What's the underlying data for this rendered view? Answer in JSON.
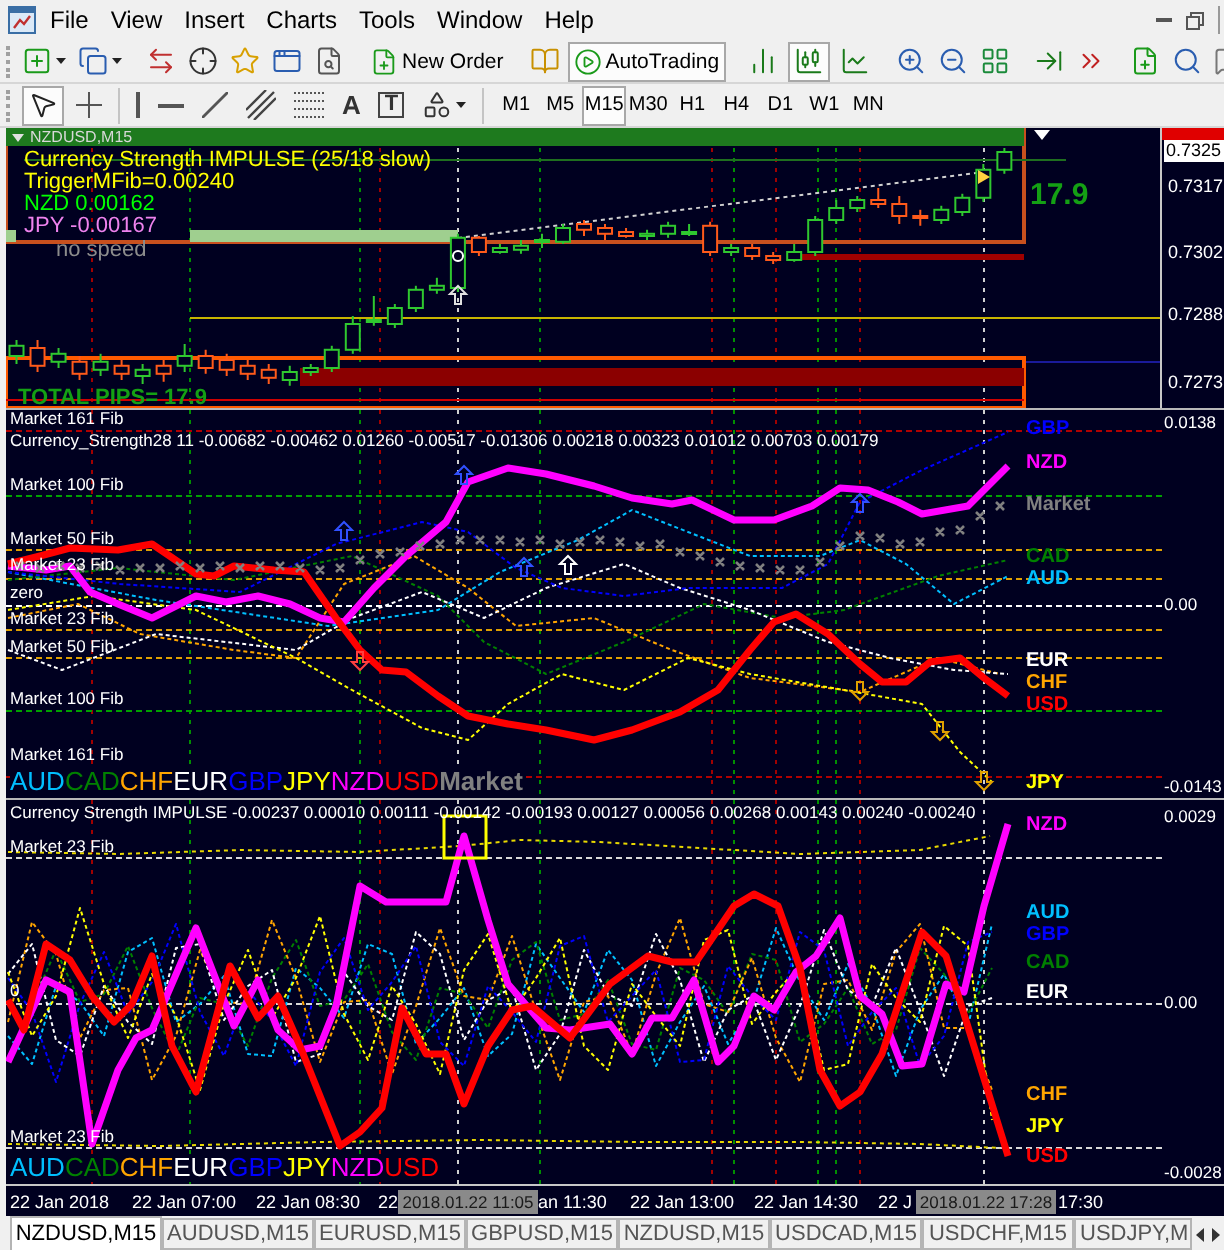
{
  "menu": {
    "items": [
      "File",
      "View",
      "Insert",
      "Charts",
      "Tools",
      "Window",
      "Help"
    ]
  },
  "toolbar": {
    "new_order": "New Order",
    "autotrading": {
      "label": "AutoTrading",
      "on": true
    },
    "chart_types": [
      {
        "kind": "bars",
        "selected": false
      },
      {
        "kind": "candles",
        "selected": true
      },
      {
        "kind": "line",
        "selected": false
      }
    ]
  },
  "drawing_toolbar": {
    "tools": [
      {
        "kind": "cursor",
        "selected": true
      },
      {
        "kind": "crosshair",
        "selected": false
      },
      {
        "kind": "vline",
        "selected": false
      },
      {
        "kind": "hline",
        "selected": false
      },
      {
        "kind": "trendline",
        "selected": false
      },
      {
        "kind": "channel",
        "selected": false
      },
      {
        "kind": "fibo",
        "selected": false
      },
      {
        "kind": "text",
        "label": "A",
        "selected": false
      },
      {
        "kind": "label",
        "label": "T",
        "selected": false
      },
      {
        "kind": "arrows",
        "selected": false
      }
    ],
    "timeframes": [
      {
        "label": "M1",
        "selected": false
      },
      {
        "label": "M5",
        "selected": false
      },
      {
        "label": "M15",
        "selected": true
      },
      {
        "label": "M30",
        "selected": false
      },
      {
        "label": "H1",
        "selected": false
      },
      {
        "label": "H4",
        "selected": false
      },
      {
        "label": "D1",
        "selected": false
      },
      {
        "label": "W1",
        "selected": false
      },
      {
        "label": "MN",
        "selected": false
      }
    ]
  },
  "chart": {
    "title": "NZDUSD,M15",
    "main_panel": {
      "info": [
        {
          "text": "Currency Strength IMPULSE (25/18 slow)",
          "color": "#ffff00"
        },
        {
          "text": "TriggerMFib=0.00240",
          "color": "#ffff00"
        },
        {
          "text": "NZD 0.00162",
          "color": "#00ff00"
        },
        {
          "text": "JPY -0.00167",
          "color": "#ee82ee"
        }
      ],
      "speed_note": "no speed",
      "pips": "17.9",
      "total_pips": "TOTAL PIPS= 17.9",
      "current_price": "0.7325",
      "chart_data": {
        "type": "candlestick",
        "categories": [
          null,
          null,
          null,
          null,
          null,
          null,
          null,
          null,
          null,
          null,
          null,
          null,
          null,
          null,
          null,
          null,
          null,
          null,
          null,
          null,
          null,
          null,
          null,
          null,
          null,
          null,
          null,
          null,
          null,
          null,
          null,
          null,
          null,
          null,
          null,
          null,
          null,
          null,
          null,
          null,
          null,
          null,
          null,
          null,
          null,
          null,
          null,
          null,
          null,
          null,
          null,
          null,
          null,
          null,
          null
        ],
        "ohlc": [
          [
            0.72787,
            0.72823,
            0.72769,
            0.7281
          ],
          [
            0.72805,
            0.72823,
            0.72751,
            0.72765
          ],
          [
            0.72774,
            0.72805,
            0.7276,
            0.72792
          ],
          [
            0.72774,
            0.72787,
            0.72733,
            0.72747
          ],
          [
            0.72756,
            0.72792,
            0.72742,
            0.72774
          ],
          [
            0.72765,
            0.72778,
            0.72733,
            0.72747
          ],
          [
            0.72742,
            0.72769,
            0.72724,
            0.72756
          ],
          [
            0.72765,
            0.72778,
            0.72729,
            0.72747
          ],
          [
            0.72765,
            0.72814,
            0.72751,
            0.72787
          ],
          [
            0.72787,
            0.72801,
            0.72747,
            0.7276
          ],
          [
            0.72778,
            0.72792,
            0.72742,
            0.72756
          ],
          [
            0.72765,
            0.72778,
            0.72733,
            0.72747
          ],
          [
            0.72756,
            0.72769,
            0.72724,
            0.72738
          ],
          [
            0.72733,
            0.72765,
            0.7272,
            0.72751
          ],
          [
            0.72751,
            0.72769,
            0.72742,
            0.7276
          ],
          [
            0.7276,
            0.7281,
            0.72751,
            0.72801
          ],
          [
            0.72801,
            0.72877,
            0.72792,
            0.72859
          ],
          [
            0.72864,
            0.72922,
            0.72855,
            0.72868
          ],
          [
            0.72859,
            0.72904,
            0.7285,
            0.72895
          ],
          [
            0.72895,
            0.72945,
            0.72886,
            0.72936
          ],
          [
            0.72936,
            0.72963,
            0.72927,
            0.72945
          ],
          [
            0.7294,
            0.73062,
            0.72931,
            0.73053
          ],
          [
            0.73053,
            0.73057,
            0.73012,
            0.73021
          ],
          [
            0.73021,
            0.73039,
            0.73017,
            0.7303
          ],
          [
            0.73026,
            0.73048,
            0.73017,
            0.73035
          ],
          [
            0.73044,
            0.73062,
            0.7303,
            0.73048
          ],
          [
            0.73044,
            0.73084,
            0.73039,
            0.73075
          ],
          [
            0.73084,
            0.73093,
            0.73057,
            0.73071
          ],
          [
            0.73075,
            0.73084,
            0.73048,
            0.73062
          ],
          [
            0.73066,
            0.73075,
            0.73053,
            0.73057
          ],
          [
            0.73057,
            0.73071,
            0.73048,
            0.73062
          ],
          [
            0.73062,
            0.73089,
            0.73053,
            0.7308
          ],
          [
            0.73062,
            0.73084,
            0.73057,
            0.73066
          ],
          [
            0.7308,
            0.73089,
            0.73012,
            0.73021
          ],
          [
            0.73021,
            0.73039,
            0.73012,
            0.7303
          ],
          [
            0.7303,
            0.73039,
            0.73003,
            0.73012
          ],
          [
            0.73012,
            0.73021,
            0.72994,
            0.73003
          ],
          [
            0.73003,
            0.73039,
            0.72999,
            0.73021
          ],
          [
            0.73021,
            0.73102,
            0.73012,
            0.73093
          ],
          [
            0.73093,
            0.73138,
            0.73084,
            0.7312
          ],
          [
            0.7312,
            0.73147,
            0.73111,
            0.73138
          ],
          [
            0.73138,
            0.73165,
            0.7312,
            0.73129
          ],
          [
            0.73129,
            0.73147,
            0.73084,
            0.73102
          ],
          [
            0.73102,
            0.73116,
            0.7308,
            0.73098
          ],
          [
            0.73093,
            0.73125,
            0.73084,
            0.73116
          ],
          [
            0.73111,
            0.73152,
            0.73102,
            0.73143
          ],
          [
            0.73143,
            0.73219,
            0.73134,
            0.73206
          ],
          [
            0.73206,
            0.73255,
            0.73197,
            0.73246
          ],
          null,
          null,
          null,
          null,
          null,
          null,
          null
        ],
        "ylim": [
          0.7267,
          0.733
        ],
        "yticks": [
          0.7317,
          0.7302,
          0.7288,
          0.7273
        ]
      }
    },
    "strength_panel": {
      "header": "Currency_Strength28 11 -0.00682 -0.00462 0.01260 -0.00517 -0.01306 0.00218 0.00323 0.01012 0.00703 0.00179",
      "levels": [
        "Market 161 Fib",
        "Market 100 Fib",
        "Market 50 Fib",
        "Market 23 Fib",
        "zero",
        "Market 23 Fib",
        "Market 50 Fib",
        "Market 100 Fib",
        "Market 161 Fib"
      ],
      "legend": [
        {
          "name": "AUD",
          "color": "#00bfff",
          "kind": "currency"
        },
        {
          "name": "CAD",
          "color": "#008000",
          "kind": "currency"
        },
        {
          "name": "CHF",
          "color": "#ffa500",
          "kind": "currency"
        },
        {
          "name": "EUR",
          "color": "#ffffff",
          "kind": "currency"
        },
        {
          "name": "GBP",
          "color": "#0000ff",
          "kind": "currency"
        },
        {
          "name": "JPY",
          "color": "#ffff00",
          "kind": "currency"
        },
        {
          "name": "NZD",
          "color": "#ff00ff",
          "kind": "currency"
        },
        {
          "name": "USD",
          "color": "#ff0000",
          "kind": "currency"
        },
        {
          "name": "Market",
          "color": "#808080",
          "kind": "index"
        }
      ],
      "line_labels": [
        {
          "name": "GBP",
          "color": "#0000ff"
        },
        {
          "name": "NZD",
          "color": "#ff00ff"
        },
        {
          "name": "Market",
          "color": "#808080"
        },
        {
          "name": "CAD",
          "color": "#008000"
        },
        {
          "name": "AUD",
          "color": "#00bfff"
        },
        {
          "name": "EUR",
          "color": "#ffffff"
        },
        {
          "name": "CHF",
          "color": "#ffa500"
        },
        {
          "name": "USD",
          "color": "#ff0000"
        },
        {
          "name": "JPY",
          "color": "#ffff00"
        }
      ],
      "price_axis": [
        "0.0138",
        "0.00",
        "-0.0143"
      ]
    },
    "impulse_panel": {
      "header": "Currency Strength IMPULSE -0.00237 0.00010 0.00111 -0.00142 -0.00193 0.00127 0.00056 0.00268 0.00143 0.00240 -0.00240",
      "levels": [
        "Market 23 Fib",
        "0",
        "Market 23 Fib"
      ],
      "legend": [
        {
          "name": "AUD",
          "color": "#00bfff",
          "kind": "currency"
        },
        {
          "name": "CAD",
          "color": "#008000",
          "kind": "currency"
        },
        {
          "name": "CHF",
          "color": "#ffa500",
          "kind": "currency"
        },
        {
          "name": "EUR",
          "color": "#ffffff",
          "kind": "currency"
        },
        {
          "name": "GBP",
          "color": "#0000ff",
          "kind": "currency"
        },
        {
          "name": "JPY",
          "color": "#ffff00",
          "kind": "currency"
        },
        {
          "name": "NZD",
          "color": "#ff00ff",
          "kind": "currency"
        },
        {
          "name": "USD",
          "color": "#ff0000",
          "kind": "currency"
        }
      ],
      "line_labels": [
        {
          "name": "NZD",
          "color": "#ff00ff"
        },
        {
          "name": "AUD",
          "color": "#00bfff"
        },
        {
          "name": "GBP",
          "color": "#0000ff"
        },
        {
          "name": "CAD",
          "color": "#008000"
        },
        {
          "name": "EUR",
          "color": "#ffffff"
        },
        {
          "name": "CHF",
          "color": "#ffa500"
        },
        {
          "name": "JPY",
          "color": "#ffff00"
        },
        {
          "name": "USD",
          "color": "#ff0000"
        }
      ],
      "price_axis": [
        "0.0029",
        "0.00",
        "-0.0028"
      ]
    },
    "time_axis": {
      "labels": [
        "22 Jan 2018",
        "22 Jan 07:00",
        "22 Jan 08:30",
        "22",
        "an 11:30",
        "22 Jan 13:00",
        "22 Jan 14:30",
        "22 J",
        "17:30"
      ],
      "crosshair_labels": [
        "2018.01.22 11:05",
        "2018.01.22 17:28"
      ]
    }
  },
  "tabs": [
    {
      "label": "NZDUSD,M15",
      "selected": true
    },
    {
      "label": "AUDUSD,M15",
      "selected": false
    },
    {
      "label": "EURUSD,M15",
      "selected": false
    },
    {
      "label": "GBPUSD,M15",
      "selected": false
    },
    {
      "label": "NZDUSD,M15",
      "selected": false
    },
    {
      "label": "USDCAD,M15",
      "selected": false
    },
    {
      "label": "USDCHF,M15",
      "selected": false
    },
    {
      "label": "USDJPY,M",
      "selected": false
    }
  ]
}
